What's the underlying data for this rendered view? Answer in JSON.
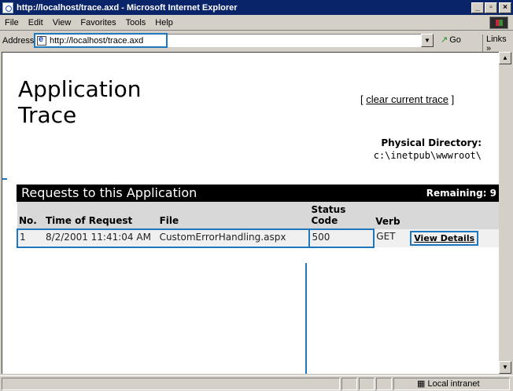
{
  "window": {
    "title": "http://localhost/trace.axd - Microsoft Internet Explorer"
  },
  "menu": [
    "File",
    "Edit",
    "View",
    "Favorites",
    "Tools",
    "Help"
  ],
  "address": {
    "label": "Address",
    "url": "http://localhost/trace.axd",
    "go": "Go",
    "links": "Links"
  },
  "page": {
    "title_line1": "Application",
    "title_line2": "Trace",
    "clear_open": "[ ",
    "clear_link": "clear current trace",
    "clear_close": " ]",
    "phys_label": "Physical Directory:",
    "phys_path": "c:\\inetpub\\wwwroot\\"
  },
  "requests": {
    "header": "Requests to this Application",
    "remaining": "Remaining: 9",
    "columns": [
      "No.",
      "Time of Request",
      "File",
      "Status Code",
      "Verb",
      ""
    ],
    "rows": [
      {
        "no": "1",
        "time": "8/2/2001 11:41:04 AM",
        "file": "CustomErrorHandling.aspx",
        "status": "500",
        "verb": "GET",
        "action": "View Details"
      }
    ]
  },
  "statusbar": {
    "zone": "Local intranet"
  },
  "colors": {
    "titlebar": "#0a246a",
    "highlight": "#1f77bd"
  }
}
